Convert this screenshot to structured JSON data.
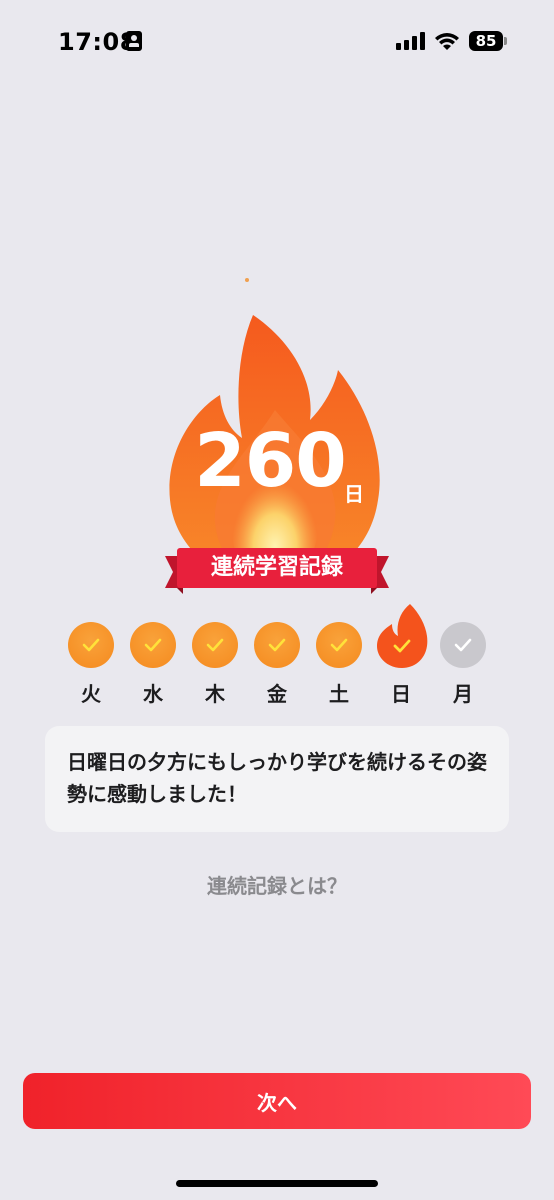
{
  "status_bar": {
    "time": "17:08",
    "battery_level": "85"
  },
  "streak": {
    "count": "260",
    "unit": "日",
    "ribbon_label": "連続学習記録"
  },
  "week": {
    "days": [
      {
        "label": "火",
        "state": "done"
      },
      {
        "label": "水",
        "state": "done"
      },
      {
        "label": "木",
        "state": "done"
      },
      {
        "label": "金",
        "state": "done"
      },
      {
        "label": "土",
        "state": "done"
      },
      {
        "label": "日",
        "state": "today"
      },
      {
        "label": "月",
        "state": "pending"
      }
    ]
  },
  "message": {
    "text": "日曜日の夕方にもしっかり学びを続けるその姿勢に感動しました！"
  },
  "about_link": "連続記録とは？",
  "next_button": "次へ",
  "colors": {
    "background": "#e9e8ee",
    "flame_primary": "#f56520",
    "ribbon": "#e8203c",
    "check_done": "#f9a23a",
    "check_pending": "#c9c8cd",
    "button": "#f0222a"
  }
}
